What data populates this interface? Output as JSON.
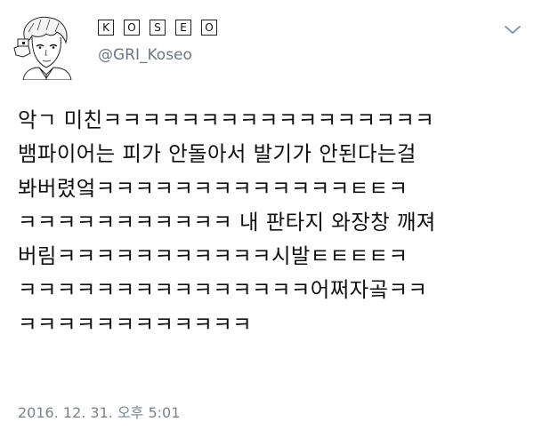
{
  "user": {
    "display_name_letters": [
      "K",
      "O",
      "S",
      "E",
      "O"
    ],
    "handle": "@GRI_Koseo"
  },
  "icons": {
    "menu": "chevron-down-icon",
    "avatar": "anime-boy-avatar-illustration"
  },
  "tweet": {
    "lines": [
      "악ㄱ 미친ㅋㅋㅋㅋㅋㅋㅋㅋㅋㅋㅋㅋㅋㅋㅋㅋㅋ",
      "뱀파이어는 피가 안돌아서 발기가 안된다는걸",
      "봐버렸엌ㅋㅋㅋㅋㅋㅋㅋㅋㅋㅋㅋㅋㅋㅌㅌㅋ",
      "ㅋㅋㅋㅋㅋㅋㅋㅋㅋㅋㅋ 내 판타지 와장창 깨져",
      "버림ㅋㅋㅋㅋㅋㅋㅋㅋㅋㅋㅋ시발ㅌㅌㅌㅌㅋ",
      "ㅋㅋㅋㅋㅋㅋㅋㅋㅋㅋㅋㅋㅋㅋㅋ어쩌자곸ㅋㅋ",
      "ㅋㅋㅋㅋㅋㅋㅋㅋㅋㅋㅋㅋ"
    ],
    "timestamp": "2016. 12. 31. 오후 5:01"
  },
  "colors": {
    "text": "#111111",
    "secondary": "#6c7782",
    "background": "#ffffff"
  }
}
